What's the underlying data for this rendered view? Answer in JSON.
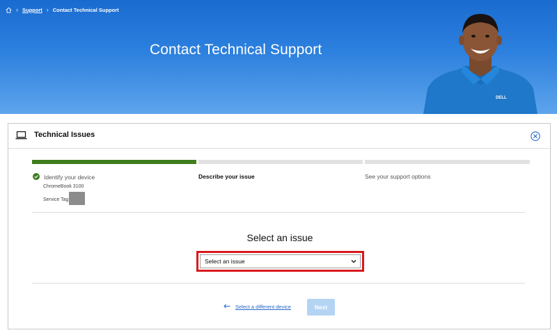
{
  "breadcrumb": {
    "home_icon": "home-icon",
    "items": [
      "Support",
      "Contact Technical Support"
    ]
  },
  "hero": {
    "title": "Contact Technical Support",
    "logo_text": "DELL",
    "bg_color": "#2c80de"
  },
  "card": {
    "title": "Technical Issues",
    "icons": {
      "header": "laptop-icon",
      "close": "close-circle-icon"
    }
  },
  "steps": {
    "progress": {
      "completed": 1,
      "total": 3
    },
    "items": [
      {
        "label": "Identify your device",
        "status": "complete",
        "color": "#3f7d1d"
      },
      {
        "label": "Describe your issue",
        "status": "current"
      },
      {
        "label": "See your support options",
        "status": "upcoming"
      }
    ],
    "device": {
      "model": "ChromeBook 3100",
      "service_tag_label": "Service Tag"
    }
  },
  "issue": {
    "heading": "Select an issue",
    "select_value": "Select an issue",
    "highlight_color": "#d9181e"
  },
  "footer": {
    "back_label": "Select a different device",
    "next_label": "Next"
  }
}
